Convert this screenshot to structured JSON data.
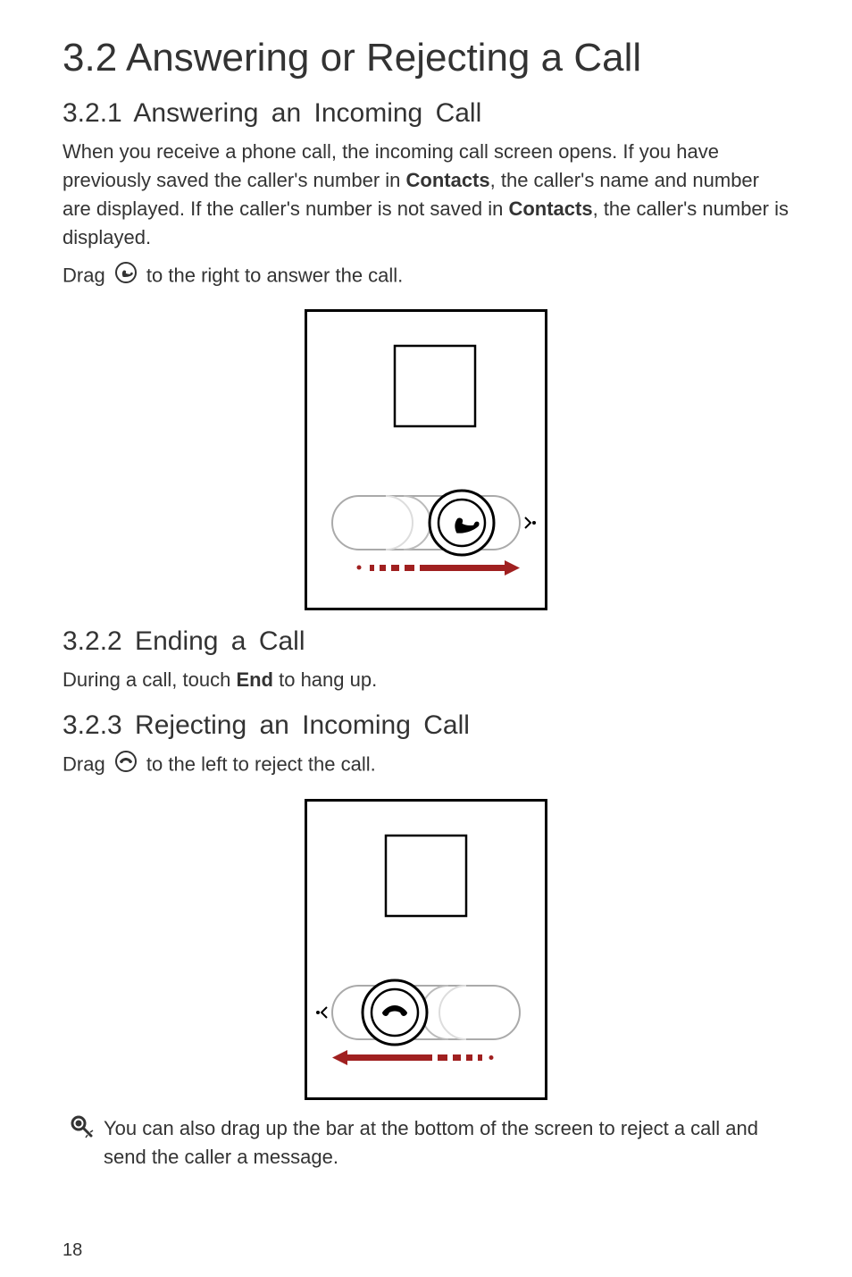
{
  "h1": "3.2  Answering or Rejecting a Call",
  "s321": {
    "title": "3.2.1  Answering an Incoming Call",
    "p1_pre": "When you receive a phone call, the incoming call screen opens. If you have previously saved the caller's number in ",
    "p1_b1": "Contacts",
    "p1_mid": ", the caller's name and number are displayed. If the caller's number is not saved in ",
    "p1_b2": "Contacts",
    "p1_post": ", the caller's number is displayed.",
    "drag_pre": "Drag ",
    "drag_post": " to the right to answer the call."
  },
  "s322": {
    "title": "3.2.2  Ending a Call",
    "p_pre": "During a call, touch ",
    "p_b": "End",
    "p_post": " to hang up."
  },
  "s323": {
    "title": "3.2.3  Rejecting an Incoming Call",
    "drag_pre": "Drag ",
    "drag_post": " to the left to reject the call."
  },
  "tip": "You can also drag up the bar at the bottom of the screen to reject a call and send the caller a message.",
  "page_number": "18"
}
